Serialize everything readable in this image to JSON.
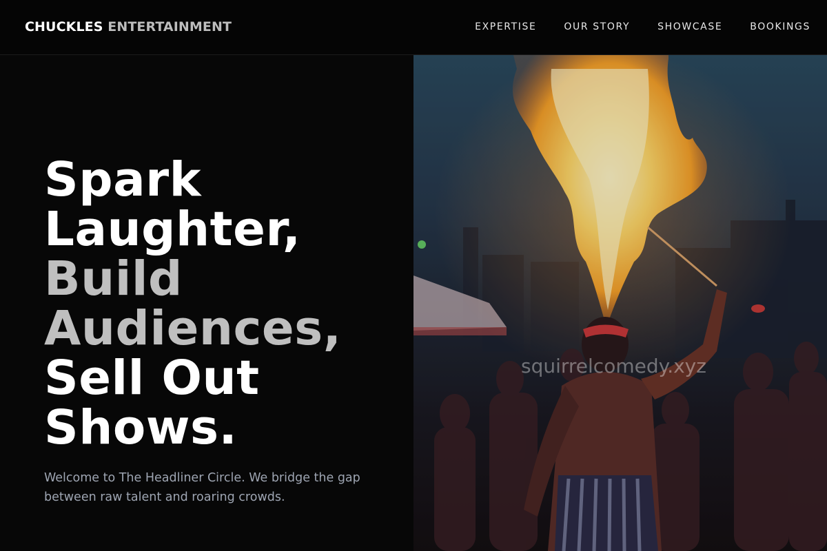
{
  "header": {
    "brand_primary": "CHUCKLES",
    "brand_secondary": "ENTERTAINMENT",
    "nav": [
      {
        "label": "EXPERTISE"
      },
      {
        "label": "OUR STORY"
      },
      {
        "label": "SHOWCASE"
      },
      {
        "label": "BOOKINGS"
      }
    ]
  },
  "hero": {
    "headline_lines": [
      {
        "text": "Spark"
      },
      {
        "text": "Laughter,"
      },
      {
        "text": "Build"
      },
      {
        "text": "Audiences,"
      },
      {
        "text": "Sell Out"
      },
      {
        "text": "Shows."
      }
    ],
    "intro": "Welcome to The Headliner Circle. We bridge the gap between raw talent and roaring crowds."
  },
  "photo": {
    "subject": "fire-breather-performer",
    "watermark": "squirrelcomedy.xyz"
  },
  "colors": {
    "background": "#070707",
    "header_background": "#050505",
    "headline_white": "#ffffff",
    "headline_gray": "#bfbfbf",
    "body_text": "#9ea5b2",
    "nav_text": "#e9e9e9"
  }
}
